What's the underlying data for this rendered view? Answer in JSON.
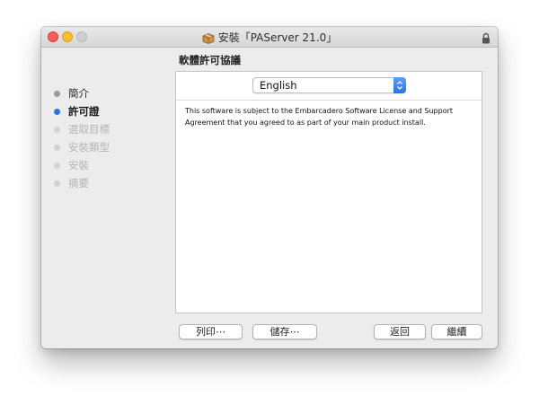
{
  "window": {
    "title": "安裝「PAServer 21.0」"
  },
  "icons": {
    "package": "package-icon",
    "lock": "lock-icon",
    "select": "chevron-updown-icon"
  },
  "colors": {
    "accent": "#2f72e6",
    "close": "#fc5b57",
    "minimize": "#fdbd2f",
    "zoom": "#cfcfcf"
  },
  "sidebar": {
    "steps": [
      {
        "label": "簡介",
        "state": "done"
      },
      {
        "label": "許可證",
        "state": "current"
      },
      {
        "label": "選取目標",
        "state": "pending"
      },
      {
        "label": "安裝類型",
        "state": "pending"
      },
      {
        "label": "安裝",
        "state": "pending"
      },
      {
        "label": "摘要",
        "state": "pending"
      }
    ]
  },
  "main": {
    "section_title": "軟體許可協議",
    "language_select": {
      "value": "English"
    },
    "license_text": "This software is subject to the Embarcadero Software License and Support Agreement that you agreed to as part of your main product install."
  },
  "buttons": {
    "print": "列印⋯",
    "save": "儲存⋯",
    "back": "返回",
    "continue": "繼續"
  }
}
